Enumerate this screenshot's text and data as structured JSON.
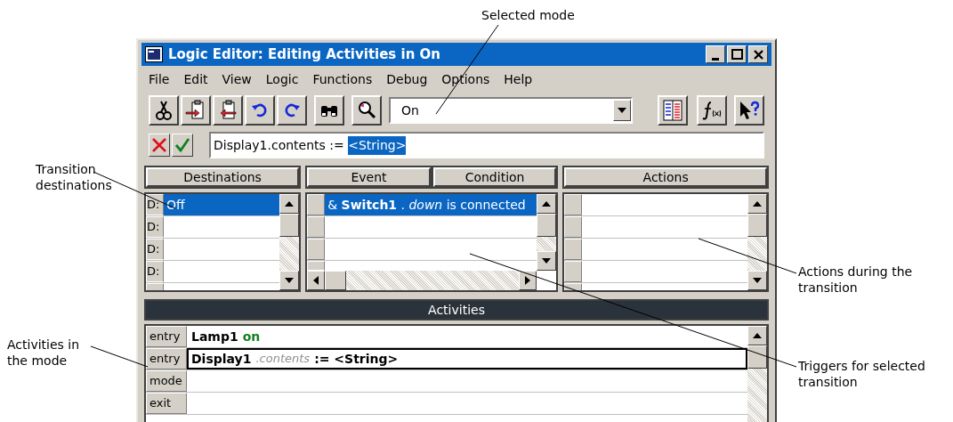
{
  "callouts": [
    {
      "text": "Selected mode"
    },
    {
      "text": "Transition destinations"
    },
    {
      "text": "Actions during the transition"
    },
    {
      "text": "Activities in the mode"
    },
    {
      "text": "Triggers for selected transition"
    }
  ],
  "window": {
    "title": "Logic Editor: Editing Activities in On"
  },
  "menu": [
    "File",
    "Edit",
    "View",
    "Logic",
    "Functions",
    "Debug",
    "Options",
    "Help"
  ],
  "mode_combo": {
    "value": "On"
  },
  "expression": {
    "value": "Display1.contents := ",
    "selection": "<String>"
  },
  "destinations": {
    "header": "Destinations",
    "rows": [
      {
        "label": "D:",
        "value": "Off",
        "selected": true
      },
      {
        "label": "D:",
        "selected": false
      },
      {
        "label": "D:",
        "selected": false
      },
      {
        "label": "D:",
        "selected": false
      }
    ]
  },
  "transitions": {
    "columns": [
      "Event",
      "Condition"
    ],
    "rows": [
      {
        "text": "& **Switch1** . *down* is connected",
        "selected": true
      }
    ]
  },
  "actions": {
    "header": "Actions"
  },
  "activities": {
    "header": "Activities",
    "rows": [
      {
        "label": "entry",
        "selected": false,
        "parts": [
          {
            "text": "Lamp1",
            "kind": "object"
          },
          {
            "text": "on",
            "kind": "state"
          }
        ]
      },
      {
        "label": "entry",
        "selected": true,
        "parts": [
          {
            "text": "Display1",
            "kind": "object"
          },
          {
            "text": ".contents",
            "kind": "property"
          },
          {
            "text": ":= <String>",
            "kind": "value"
          }
        ]
      },
      {
        "label": "mode",
        "selected": false
      },
      {
        "label": "exit",
        "selected": false
      }
    ]
  }
}
